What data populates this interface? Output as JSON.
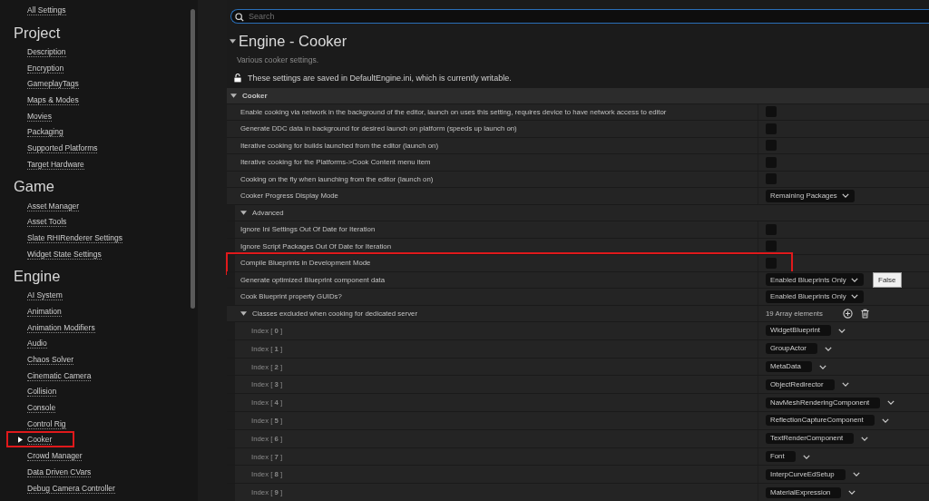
{
  "sidebar": {
    "entries": [
      {
        "kind": "link",
        "label": "All Settings",
        "selected": false,
        "highlighted": false
      },
      {
        "kind": "heading",
        "label": "Project"
      },
      {
        "kind": "link",
        "label": "Description",
        "selected": false,
        "highlighted": false
      },
      {
        "kind": "link",
        "label": "Encryption",
        "selected": false,
        "highlighted": false
      },
      {
        "kind": "link",
        "label": "GameplayTags",
        "selected": false,
        "highlighted": false
      },
      {
        "kind": "link",
        "label": "Maps & Modes",
        "selected": false,
        "highlighted": false
      },
      {
        "kind": "link",
        "label": "Movies",
        "selected": false,
        "highlighted": false
      },
      {
        "kind": "link",
        "label": "Packaging",
        "selected": false,
        "highlighted": false
      },
      {
        "kind": "link",
        "label": "Supported Platforms",
        "selected": false,
        "highlighted": false
      },
      {
        "kind": "link",
        "label": "Target Hardware",
        "selected": false,
        "highlighted": false
      },
      {
        "kind": "heading",
        "label": "Game"
      },
      {
        "kind": "link",
        "label": "Asset Manager",
        "selected": false,
        "highlighted": false
      },
      {
        "kind": "link",
        "label": "Asset Tools",
        "selected": false,
        "highlighted": false
      },
      {
        "kind": "link",
        "label": "Slate RHIRenderer Settings",
        "selected": false,
        "highlighted": false
      },
      {
        "kind": "link",
        "label": "Widget State Settings",
        "selected": false,
        "highlighted": false
      },
      {
        "kind": "heading",
        "label": "Engine"
      },
      {
        "kind": "link",
        "label": "AI System",
        "selected": false,
        "highlighted": false
      },
      {
        "kind": "link",
        "label": "Animation",
        "selected": false,
        "highlighted": false
      },
      {
        "kind": "link",
        "label": "Animation Modifiers",
        "selected": false,
        "highlighted": false
      },
      {
        "kind": "link",
        "label": "Audio",
        "selected": false,
        "highlighted": false
      },
      {
        "kind": "link",
        "label": "Chaos Solver",
        "selected": false,
        "highlighted": false
      },
      {
        "kind": "link",
        "label": "Cinematic Camera",
        "selected": false,
        "highlighted": false
      },
      {
        "kind": "link",
        "label": "Collision",
        "selected": false,
        "highlighted": false
      },
      {
        "kind": "link",
        "label": "Console",
        "selected": false,
        "highlighted": false
      },
      {
        "kind": "link",
        "label": "Control Rig",
        "selected": false,
        "highlighted": false
      },
      {
        "kind": "link",
        "label": "Cooker",
        "selected": true,
        "highlighted": true
      },
      {
        "kind": "link",
        "label": "Crowd Manager",
        "selected": false,
        "highlighted": false
      },
      {
        "kind": "link",
        "label": "Data Driven CVars",
        "selected": false,
        "highlighted": false
      },
      {
        "kind": "link",
        "label": "Debug Camera Controller",
        "selected": false,
        "highlighted": false
      }
    ]
  },
  "search": {
    "placeholder": "Search"
  },
  "page": {
    "title": "Engine - Cooker",
    "expanded": true,
    "description": "Various cooker settings.",
    "notice": "These settings are saved in DefaultEngine.ini, which is currently writable."
  },
  "section": {
    "label": "Cooker",
    "expanded": true,
    "rows": [
      {
        "kind": "checkbox",
        "label": "Enable cooking via network in the background of the editor, launch on uses this setting, requires device to have network access to editor",
        "checked": false,
        "highlighted": false
      },
      {
        "kind": "checkbox",
        "label": "Generate DDC data in background for desired launch on platform (speeds up launch on)",
        "checked": false,
        "highlighted": false
      },
      {
        "kind": "checkbox",
        "label": "Iterative cooking for builds launched from the editor (launch on)",
        "checked": false,
        "highlighted": false
      },
      {
        "kind": "checkbox",
        "label": "Iterative cooking for the Platforms->Cook Content menu item",
        "checked": false,
        "highlighted": false
      },
      {
        "kind": "checkbox",
        "label": "Cooking on the fly when launching from the editor (launch on)",
        "checked": false,
        "highlighted": false
      },
      {
        "kind": "dropdown",
        "label": "Cooker Progress Display Mode",
        "value": "Remaining Packages"
      },
      {
        "kind": "group",
        "label": "Advanced",
        "expanded": true,
        "children": [
          {
            "kind": "checkbox",
            "label": "Ignore Ini Settings Out Of Date for Iteration",
            "checked": false,
            "highlighted": false
          },
          {
            "kind": "checkbox",
            "label": "Ignore Script Packages Out Of Date for Iteration",
            "checked": false,
            "highlighted": false
          },
          {
            "kind": "checkbox",
            "label": "Compile Blueprints in Development Mode",
            "checked": false,
            "highlighted": true,
            "tooltip": "False"
          },
          {
            "kind": "dropdown",
            "label": "Generate optimized Blueprint component data",
            "value": "Enabled Blueprints Only"
          },
          {
            "kind": "dropdown",
            "label": "Cook Blueprint property GUIDs?",
            "value": "Enabled Blueprints Only"
          }
        ]
      },
      {
        "kind": "array",
        "label": "Classes excluded when cooking for dedicated server",
        "expanded": true,
        "count": "19 Array elements",
        "items": [
          {
            "label": "Index [ **0** ]",
            "value": "WidgetBlueprint"
          },
          {
            "label": "Index [ **1** ]",
            "value": "GroupActor"
          },
          {
            "label": "Index [ **2** ]",
            "value": "MetaData"
          },
          {
            "label": "Index [ **3** ]",
            "value": "ObjectRedirector"
          },
          {
            "label": "Index [ **4** ]",
            "value": "NavMeshRenderingComponent"
          },
          {
            "label": "Index [ **5** ]",
            "value": "ReflectionCaptureComponent"
          },
          {
            "label": "Index [ **6** ]",
            "value": "TextRenderComponent"
          },
          {
            "label": "Index [ **7** ]",
            "value": "Font"
          },
          {
            "label": "Index [ **8** ]",
            "value": "InterpCurveEdSetup"
          },
          {
            "label": "Index [ **9** ]",
            "value": "MaterialExpression"
          }
        ]
      }
    ]
  }
}
